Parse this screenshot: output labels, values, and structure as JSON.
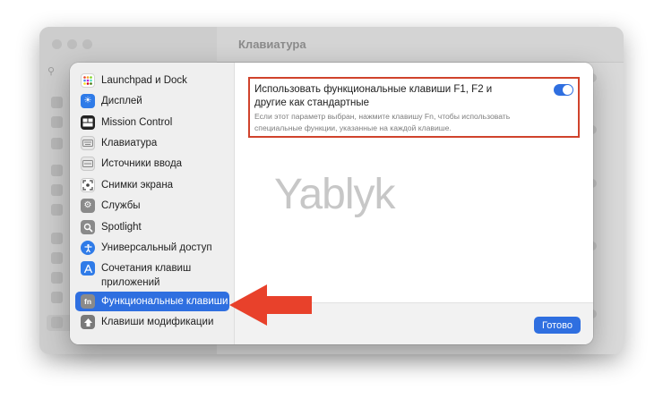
{
  "window": {
    "title": "Клавиатура"
  },
  "sidebar": {
    "items": [
      {
        "label": "Launchpad и Dock",
        "icon": "launchpad-icon"
      },
      {
        "label": "Дисплей",
        "icon": "display-icon"
      },
      {
        "label": "Mission Control",
        "icon": "mission-control-icon"
      },
      {
        "label": "Клавиатура",
        "icon": "keyboard-icon"
      },
      {
        "label": "Источники ввода",
        "icon": "input-sources-icon"
      },
      {
        "label": "Снимки экрана",
        "icon": "screenshot-icon"
      },
      {
        "label": "Службы",
        "icon": "services-icon"
      },
      {
        "label": "Spotlight",
        "icon": "spotlight-icon"
      },
      {
        "label": "Универсальный доступ",
        "icon": "accessibility-icon"
      },
      {
        "label": "Сочетания клавиш приложений",
        "icon": "app-shortcuts-icon"
      },
      {
        "label": "Функциональные клавиши",
        "icon": "fn-icon",
        "selected": true
      },
      {
        "label": "Клавиши модификации",
        "icon": "modifier-keys-icon"
      }
    ]
  },
  "main": {
    "setting": {
      "title": "Использовать функциональные клавиши F1, F2 и другие как стандартные",
      "description": "Если этот параметр выбран, нажмите клавишу Fn, чтобы использовать специальные функции, указанные на каждой клавише.",
      "enabled": true
    },
    "watermark": "Yablyk",
    "done_label": "Готово",
    "fn_icon_text": "fn"
  },
  "colors": {
    "accent": "#2f6fe0",
    "highlight": "#d0432c",
    "arrow": "#e8412b"
  }
}
